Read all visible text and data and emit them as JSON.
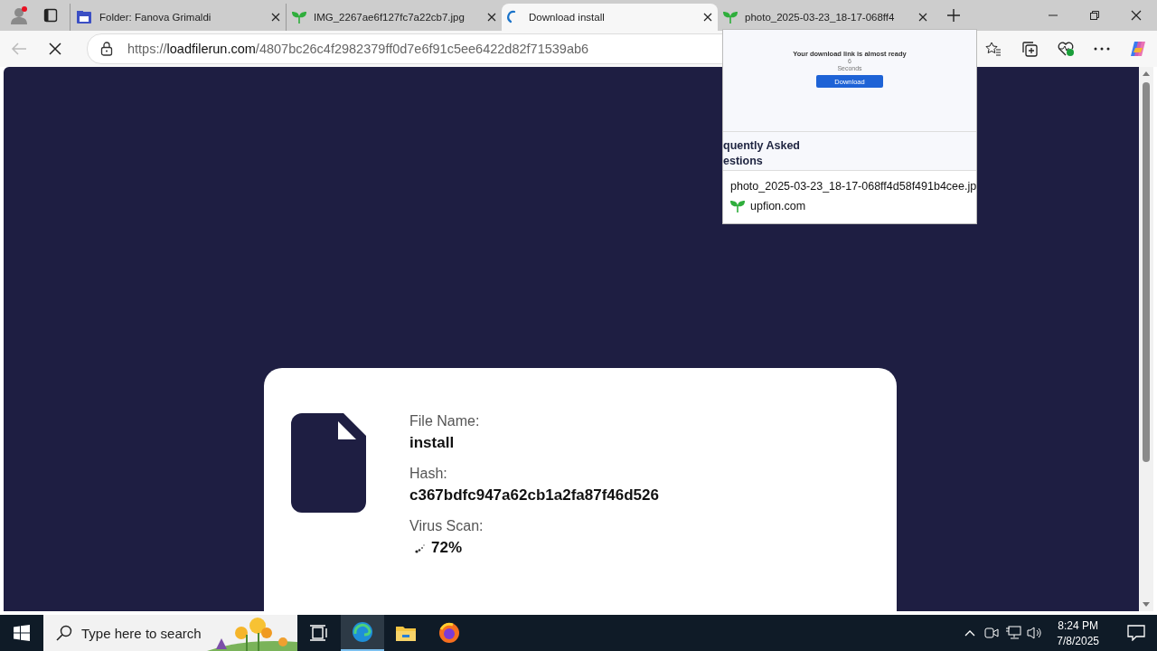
{
  "tabs": [
    {
      "title": "Folder: Fanova Grimaldi",
      "kind": "folder",
      "selected": false
    },
    {
      "title": "IMG_2267ae6f127fc7a22cb7.jpg",
      "kind": "sprout",
      "selected": false
    },
    {
      "title": "Download install",
      "kind": "loading",
      "selected": true
    },
    {
      "title": "photo_2025-03-23_18-17-068ff4",
      "kind": "sprout",
      "selected": false
    }
  ],
  "address": {
    "scheme": "https://",
    "domain": "loadfilerun.com",
    "path": "/4807bc26c4f2982379ff0d7e6f91c5ee6422d82f71539ab6"
  },
  "tab_preview": {
    "page_heading": "Your download link is almost ready",
    "countdown": "6",
    "countdown_unit": "Seconds",
    "button": "Download",
    "section_line_1": "quently Asked",
    "section_line_2": "estions",
    "title": "photo_2025-03-23_18-17-068ff4d58f491b4cee.jp",
    "site": "upfion.com"
  },
  "file_card": {
    "fields": [
      {
        "label": "File Name:",
        "value": "install",
        "kind": "text"
      },
      {
        "label": "Hash:",
        "value": "c367bdfc947a62cb1a2fa87f46d526",
        "kind": "text"
      },
      {
        "label": "Virus Scan:",
        "value": "72%",
        "kind": "scan"
      }
    ]
  },
  "taskbar": {
    "search_placeholder": "Type here to search",
    "time": "8:24 PM",
    "date": "7/8/2025"
  }
}
